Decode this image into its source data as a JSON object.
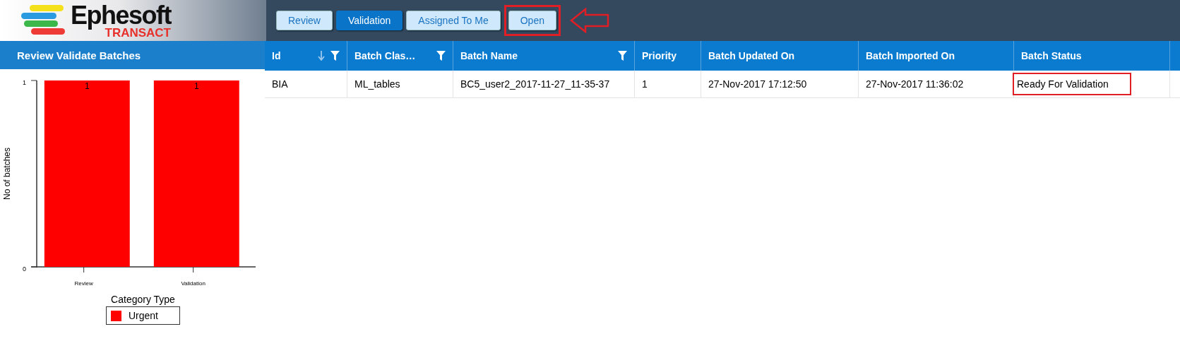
{
  "logo": {
    "name": "Ephesoft",
    "product": "TRANSACT"
  },
  "toolbar": {
    "buttons": [
      {
        "label": "Review",
        "selected": false,
        "highlighted": false
      },
      {
        "label": "Validation",
        "selected": true,
        "highlighted": false
      },
      {
        "label": "Assigned To Me",
        "selected": false,
        "highlighted": false
      },
      {
        "label": "Open",
        "selected": false,
        "highlighted": true
      }
    ]
  },
  "sidebar": {
    "title": "Review Validate Batches",
    "chart_data": {
      "type": "bar",
      "ylabel": "No of batches",
      "categories": [
        "Review",
        "Validation"
      ],
      "yticks": [
        0,
        1
      ],
      "ylim": [
        0,
        1
      ],
      "data_labels": true,
      "legend_title": "Category Type",
      "series": [
        {
          "name": "Urgent",
          "color": "#ff0000",
          "values": [
            1,
            1
          ]
        }
      ]
    }
  },
  "table": {
    "columns": [
      {
        "label": "Id",
        "sorted": true,
        "filter": true
      },
      {
        "label": "Batch Clas…",
        "filter": true
      },
      {
        "label": "Batch Name",
        "filter": true
      },
      {
        "label": "Priority",
        "filter": false
      },
      {
        "label": "Batch Updated On",
        "filter": false
      },
      {
        "label": "Batch Imported On",
        "filter": false
      },
      {
        "label": "Batch Status",
        "filter": false
      }
    ],
    "rows": [
      {
        "cells": [
          {
            "text": "BIA",
            "highlighted": false
          },
          {
            "text": "ML_tables",
            "highlighted": false
          },
          {
            "text": "BC5_user2_2017-11-27_11-35-37",
            "highlighted": false
          },
          {
            "text": "1",
            "highlighted": false
          },
          {
            "text": "27-Nov-2017 17:12:50",
            "highlighted": false
          },
          {
            "text": "27-Nov-2017 11:36:02",
            "highlighted": false
          },
          {
            "text": "Ready For Validation",
            "highlighted": true
          }
        ]
      }
    ]
  }
}
